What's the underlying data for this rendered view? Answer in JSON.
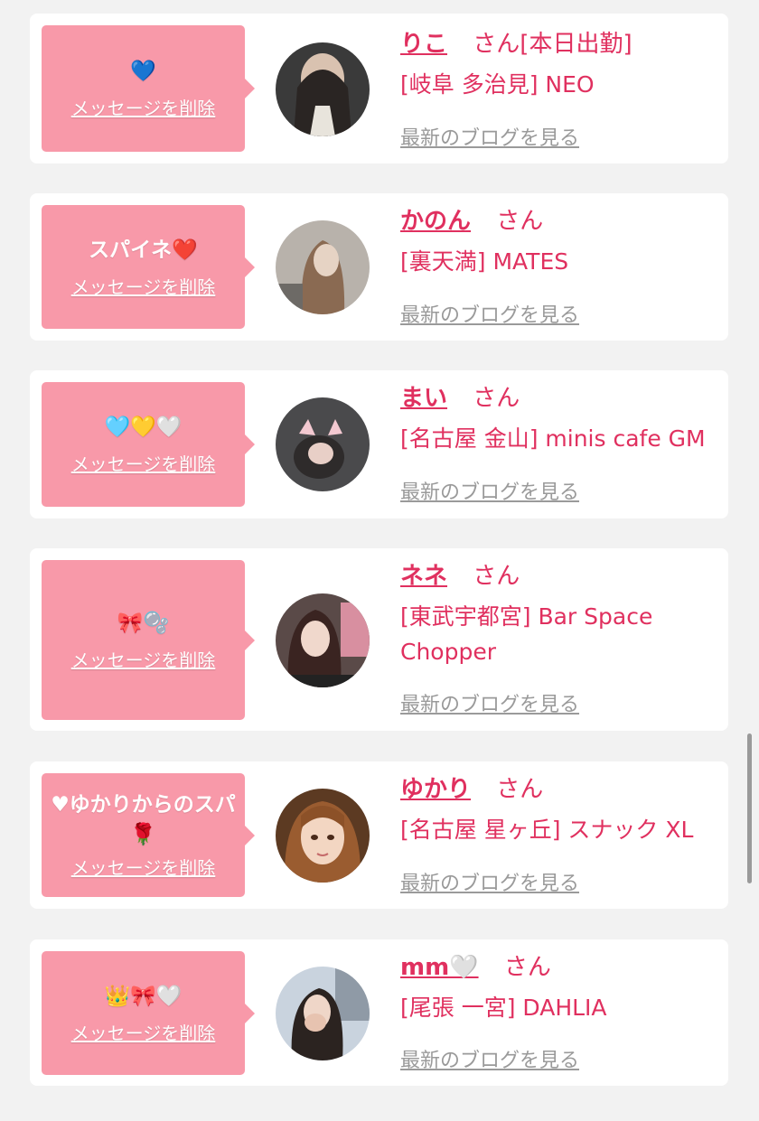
{
  "common": {
    "delete_label": "メッセージを削除",
    "blog_label": "最新のブログを見る",
    "honorific": "さん"
  },
  "entries": [
    {
      "message": "💙",
      "name": "りこ",
      "name_suffix": "[本日出勤]",
      "shop": "[岐阜 多治見] NEO",
      "avatar_icon": "photo-avatar"
    },
    {
      "message": "スパイネ❤️",
      "name": "かのん",
      "name_suffix": "",
      "shop": "[裏天満] MATES",
      "avatar_icon": "photo-avatar"
    },
    {
      "message": "🩵💛🤍",
      "name": "まい",
      "name_suffix": "",
      "shop": "[名古屋 金山] minis cafe GM",
      "avatar_icon": "photo-avatar"
    },
    {
      "message": "🎀🫧",
      "name": "ネネ",
      "name_suffix": "",
      "shop": "[東武宇都宮] Bar Space Chopper",
      "avatar_icon": "photo-avatar"
    },
    {
      "message": "♥ゆかりからのスパ🌹",
      "name": "ゆかり",
      "name_suffix": "",
      "shop": "[名古屋 星ヶ丘] スナック XL",
      "avatar_icon": "illustration-avatar"
    },
    {
      "message": "👑🎀🤍",
      "name": "mm🤍",
      "name_suffix": "",
      "shop": "[尾張 一宮] DAHLIA",
      "avatar_icon": "photo-avatar"
    }
  ],
  "colors": {
    "background": "#f2f2f2",
    "card": "#ffffff",
    "bubble": "#f899a9",
    "accent": "#e0305f",
    "muted": "#9a9a9a"
  }
}
